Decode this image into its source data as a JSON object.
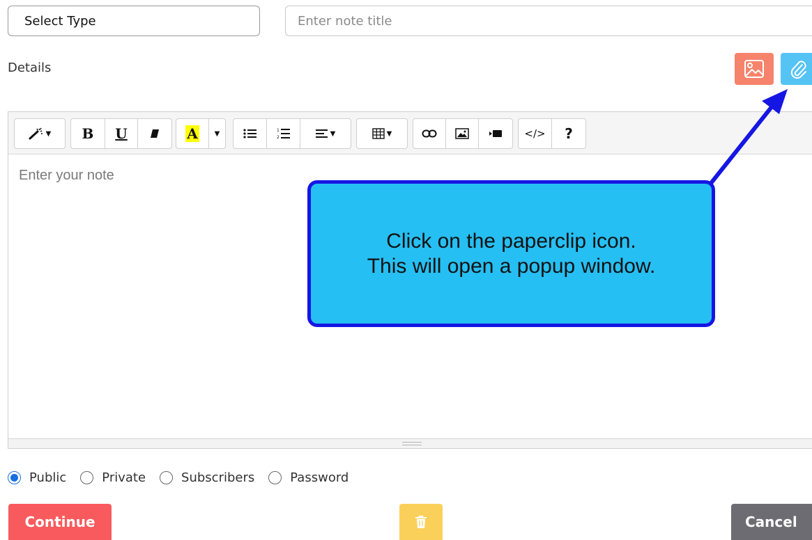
{
  "form": {
    "select_type": "Select Type",
    "title_placeholder": "Enter note title",
    "details_label": "Details"
  },
  "editor": {
    "placeholder": "Enter your note",
    "toolbar": {
      "bold": "B",
      "underline": "U",
      "highlight": "A",
      "code": "</>",
      "help": "?"
    }
  },
  "callout": {
    "line1": "Click on the paperclip icon.",
    "line2": "This will open a popup window."
  },
  "visibility": {
    "options": [
      "Public",
      "Private",
      "Subscribers",
      "Password"
    ],
    "selected": "Public"
  },
  "actions": {
    "continue": "Continue",
    "cancel": "Cancel"
  },
  "colors": {
    "image_button": "#f6836b",
    "attach_button": "#56c3f5",
    "continue_button": "#f95a5d",
    "delete_button": "#fbd05a",
    "cancel_button": "#6c6c72",
    "callout_fill": "#26bff3",
    "callout_border": "#1616e4"
  },
  "icons": [
    "magic-wand-icon",
    "eraser-icon",
    "unordered-list-icon",
    "ordered-list-icon",
    "align-icon",
    "table-icon",
    "link-icon",
    "picture-icon",
    "video-icon",
    "image-icon",
    "paperclip-icon",
    "trash-icon"
  ]
}
